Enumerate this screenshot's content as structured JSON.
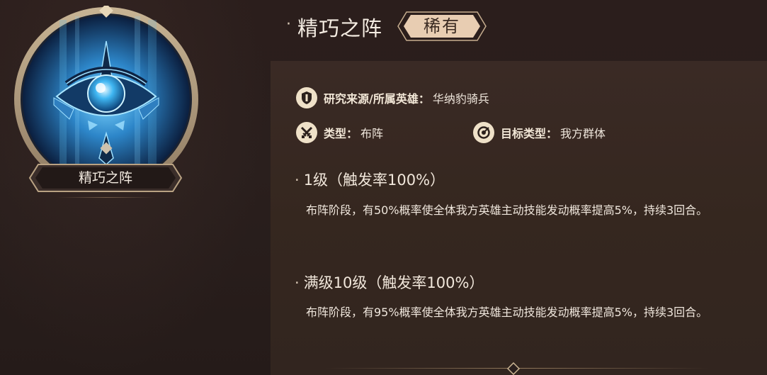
{
  "skill": {
    "name": "精巧之阵",
    "emblem_label": "精巧之阵",
    "rarity": "稀有"
  },
  "meta": {
    "source_label": "研究来源/所属英雄：",
    "source_value": "华纳豹骑兵",
    "type_label": "类型：",
    "type_value": "布阵",
    "target_label": "目标类型：",
    "target_value": "我方群体"
  },
  "levels": [
    {
      "title": "1级（触发率100%）",
      "description": "布阵阶段，有50%概率使全体我方英雄主动技能发动概率提高5%，持续3回合。"
    },
    {
      "title": "满级10级（触发率100%）",
      "description": "布阵阶段，有95%概率使全体我方英雄主动技能发动概率提高5%，持续3回合。"
    }
  ],
  "icons": {
    "source": "shield-icon",
    "type": "crossed-swords-icon",
    "target": "target-icon",
    "emblem": "eye-emblem-icon"
  },
  "colors": {
    "background": "#2a1f1d",
    "panel": "#36282a",
    "gold_frame": "#b9a283",
    "rarity_badge": "#e8cdb2",
    "icon_badge": "#efe1c8",
    "emblem_glow": "#3fa9e6"
  }
}
